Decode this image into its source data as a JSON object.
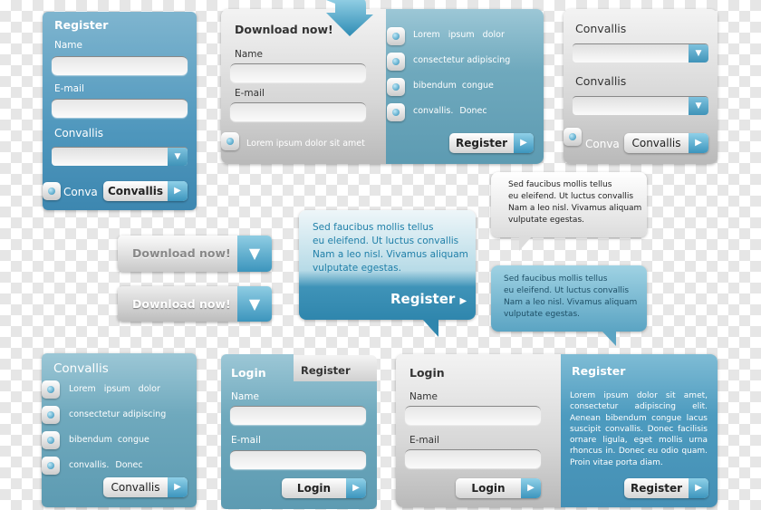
{
  "register_panel": {
    "title": "Register",
    "name_label": "Name",
    "email_label": "E-mail",
    "select_label": "Convallis",
    "radio_label": "Conva",
    "button": "Convallis"
  },
  "download_panel": {
    "title": "Download now!",
    "name_label": "Name",
    "email_label": "E-mail",
    "radio_label": "Lorem ipsum dolor sit amet",
    "items": [
      "Lorem ipsum dolor",
      "consectetur adipiscing",
      "bibendum congue",
      "convallis. Donec"
    ],
    "button": "Register"
  },
  "select_panel": {
    "label1": "Convallis",
    "label2": "Convallis",
    "radio_label": "Conva",
    "button": "Convallis"
  },
  "download_buttons": [
    "Download now!",
    "Download now!"
  ],
  "bubble_main": {
    "lines": [
      "Sed faucibus mollis tellus",
      "eu eleifend. Ut luctus convallis",
      "Nam a leo nisl. Vivamus aliquam",
      "vulputate egestas."
    ],
    "button": "Register"
  },
  "bubble_gray": {
    "lines": [
      "Sed faucibus mollis tellus",
      "eu eleifend. Ut luctus convallis",
      "Nam a leo nisl. Vivamus aliquam",
      "vulputate egestas."
    ]
  },
  "bubble_blue": {
    "lines": [
      "Sed faucibus mollis tellus",
      "eu eleifend. Ut luctus convallis",
      "Nam a leo nisl. Vivamus aliquam",
      "vulputate egestas."
    ]
  },
  "list_panel": {
    "title": "Convallis",
    "items": [
      "Lorem ipsum dolor",
      "consectetur adipiscing",
      "bibendum congue",
      "convallis. Donec"
    ],
    "button": "Convallis"
  },
  "tabs_panel": {
    "tab_login": "Login",
    "tab_register": "Register",
    "name_label": "Name",
    "email_label": "E-mail",
    "button": "Login"
  },
  "wide_panel": {
    "login_title": "Login",
    "name_label": "Name",
    "email_label": "E-mail",
    "login_button": "Login",
    "register_title": "Register",
    "register_text": "Lorem ipsum dolor sit amet, consectetur adipiscing elit. Aenean bibendum congue lacus suscipit convallis. Donec facilisis ornare ligula, eget mollis urna rhoncus in. Donec eu odio quam. Proin vitae porta diam.",
    "register_button": "Register"
  },
  "colors": {
    "accent": "#4f97bd",
    "teal": "#6fa9bd",
    "gray": "#d6d6d6"
  }
}
